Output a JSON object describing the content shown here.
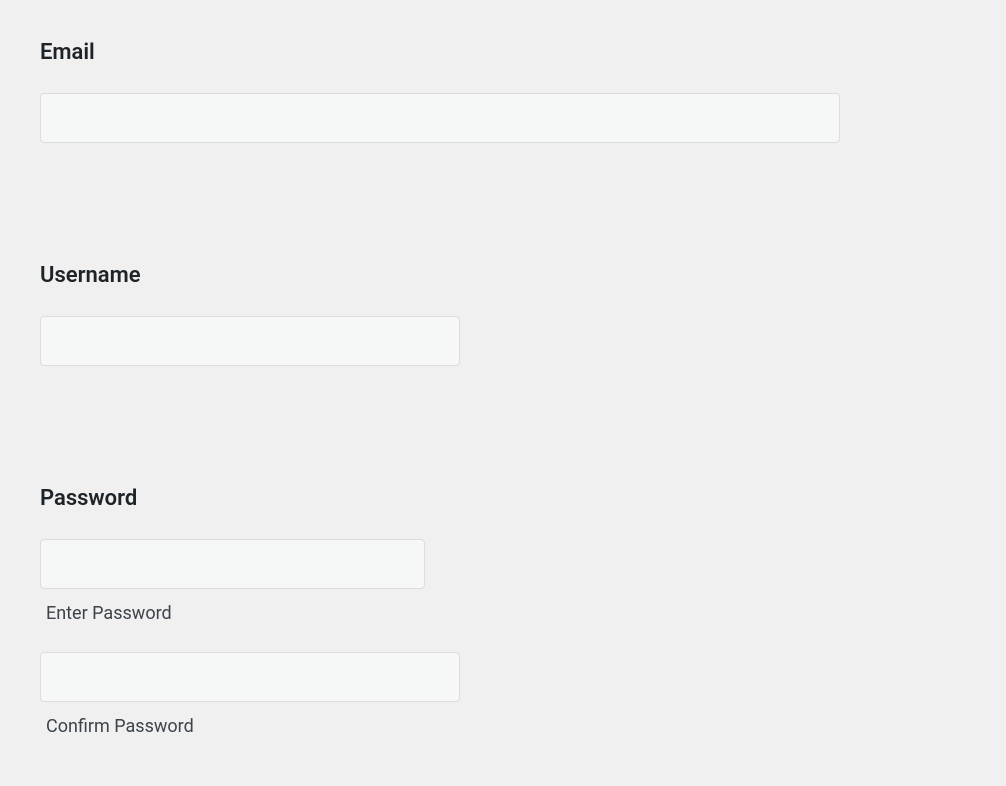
{
  "form": {
    "email": {
      "label": "Email",
      "value": ""
    },
    "username": {
      "label": "Username",
      "value": ""
    },
    "password": {
      "label": "Password",
      "enter": {
        "value": "",
        "sublabel": "Enter Password"
      },
      "confirm": {
        "value": "",
        "sublabel": "Confirm Password"
      }
    }
  }
}
